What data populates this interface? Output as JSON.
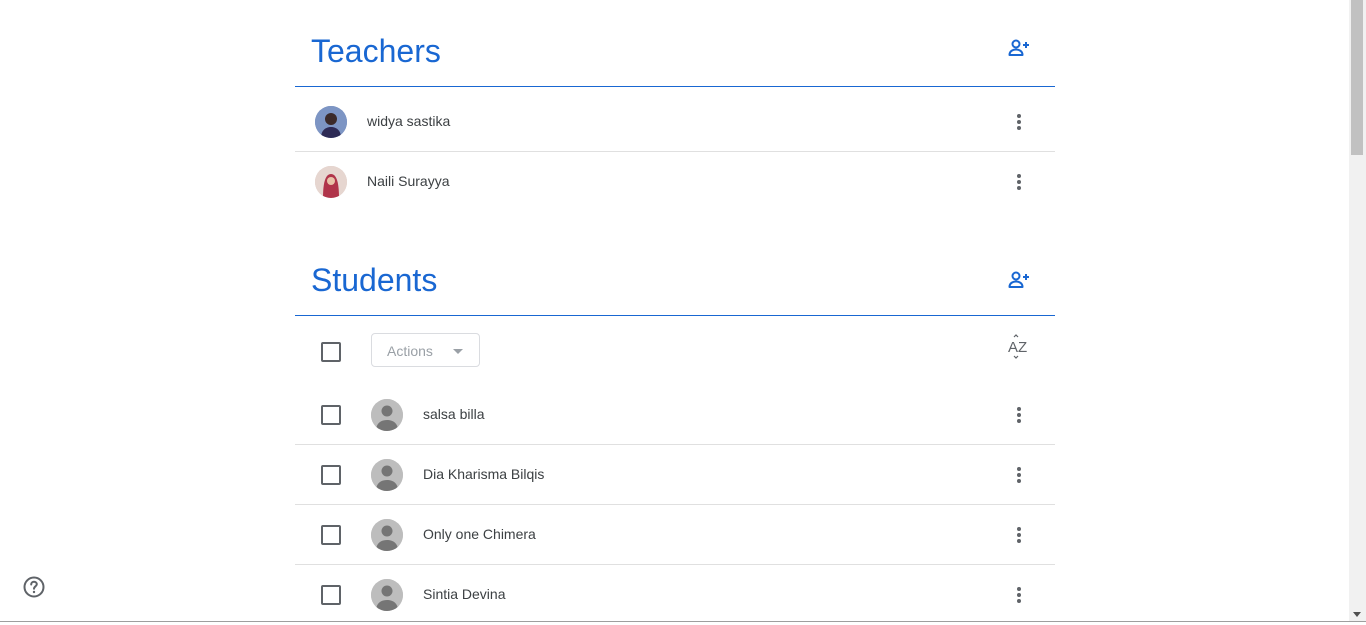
{
  "teachers": {
    "title": "Teachers",
    "items": [
      {
        "name": "widya sastika"
      },
      {
        "name": "Naili Surayya"
      }
    ]
  },
  "students": {
    "title": "Students",
    "actions_label": "Actions",
    "items": [
      {
        "name": "salsa billa"
      },
      {
        "name": "Dia Kharisma Bilqis"
      },
      {
        "name": "Only one Chimera"
      },
      {
        "name": "Sintia Devina"
      }
    ]
  },
  "colors": {
    "accent": "#1967d2",
    "text": "#3c4043",
    "divider": "#e0e0e0"
  },
  "icons": {
    "add_person": "person-add-icon",
    "more": "more-vert-icon",
    "sort": "sort-az-icon",
    "help": "help-icon"
  }
}
